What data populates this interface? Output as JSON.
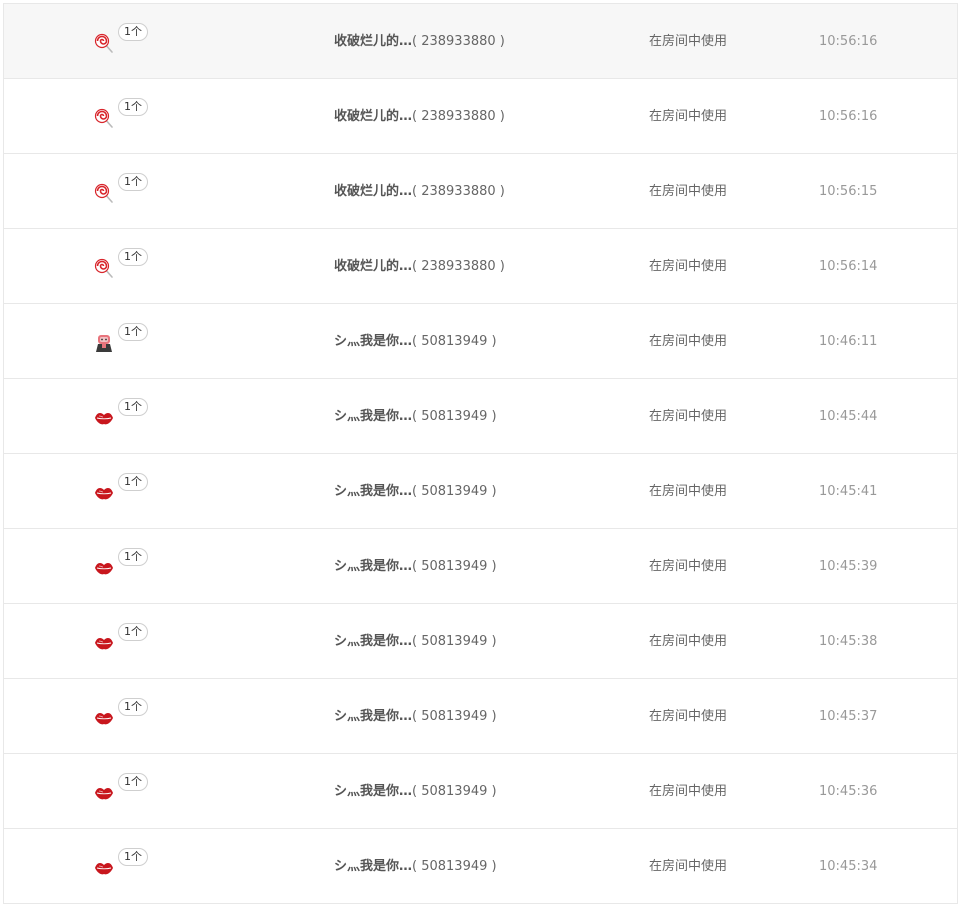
{
  "rows": [
    {
      "icon": "lollipop-icon",
      "count": "1个",
      "name": "收破烂儿的…",
      "id": "( 238933880 )",
      "usage": "在房间中使用",
      "time": "10:56:16"
    },
    {
      "icon": "lollipop-icon",
      "count": "1个",
      "name": "收破烂儿的…",
      "id": "( 238933880 )",
      "usage": "在房间中使用",
      "time": "10:56:16"
    },
    {
      "icon": "lollipop-icon",
      "count": "1个",
      "name": "收破烂儿的…",
      "id": "( 238933880 )",
      "usage": "在房间中使用",
      "time": "10:56:15"
    },
    {
      "icon": "lollipop-icon",
      "count": "1个",
      "name": "收破烂儿的…",
      "id": "( 238933880 )",
      "usage": "在房间中使用",
      "time": "10:56:14"
    },
    {
      "icon": "character-icon",
      "count": "1个",
      "name": "シ灬我是你…",
      "id": "( 50813949 )",
      "usage": "在房间中使用",
      "time": "10:46:11"
    },
    {
      "icon": "lips-icon",
      "count": "1个",
      "name": "シ灬我是你…",
      "id": "( 50813949 )",
      "usage": "在房间中使用",
      "time": "10:45:44"
    },
    {
      "icon": "lips-icon",
      "count": "1个",
      "name": "シ灬我是你…",
      "id": "( 50813949 )",
      "usage": "在房间中使用",
      "time": "10:45:41"
    },
    {
      "icon": "lips-icon",
      "count": "1个",
      "name": "シ灬我是你…",
      "id": "( 50813949 )",
      "usage": "在房间中使用",
      "time": "10:45:39"
    },
    {
      "icon": "lips-icon",
      "count": "1个",
      "name": "シ灬我是你…",
      "id": "( 50813949 )",
      "usage": "在房间中使用",
      "time": "10:45:38"
    },
    {
      "icon": "lips-icon",
      "count": "1个",
      "name": "シ灬我是你…",
      "id": "( 50813949 )",
      "usage": "在房间中使用",
      "time": "10:45:37"
    },
    {
      "icon": "lips-icon",
      "count": "1个",
      "name": "シ灬我是你…",
      "id": "( 50813949 )",
      "usage": "在房间中使用",
      "time": "10:45:36"
    },
    {
      "icon": "lips-icon",
      "count": "1个",
      "name": "シ灬我是你…",
      "id": "( 50813949 )",
      "usage": "在房间中使用",
      "time": "10:45:34"
    }
  ],
  "colors": {
    "row_highlight": "#f7f7f7",
    "divider": "#e8e8e8",
    "lips_red": "#c8161d",
    "lollipop_red": "#d8252b"
  }
}
